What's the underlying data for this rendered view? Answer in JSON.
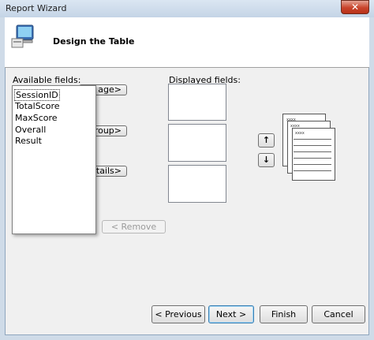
{
  "window": {
    "title": "Report Wizard",
    "close_symbol": "✕"
  },
  "header": {
    "heading": "Design the Table"
  },
  "available": {
    "label": "Available fields:",
    "items": [
      "SessionID",
      "TotalScore",
      "MaxScore",
      "Overall",
      "Result"
    ],
    "buttons": [
      "age>",
      "roup>",
      "tails>"
    ]
  },
  "displayed": {
    "label": "Displayed fields:"
  },
  "move": {
    "up": "↑",
    "down": "↓"
  },
  "remove_label": "< Remove",
  "preview_text": "xxxx",
  "footer": {
    "previous": "< Previous",
    "next": "Next >",
    "finish": "Finish",
    "cancel": "Cancel"
  }
}
